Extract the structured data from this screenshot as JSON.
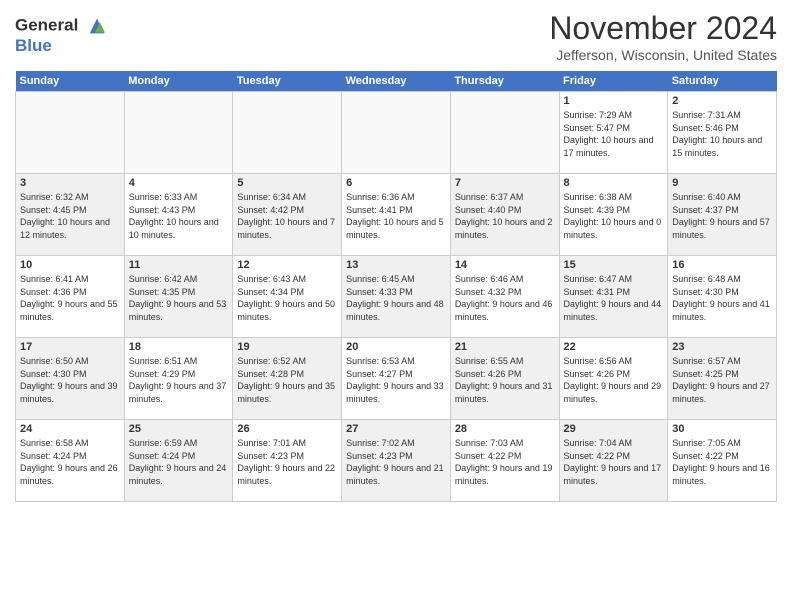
{
  "header": {
    "logo_line1": "General",
    "logo_line2": "Blue",
    "month_year": "November 2024",
    "location": "Jefferson, Wisconsin, United States"
  },
  "days_of_week": [
    "Sunday",
    "Monday",
    "Tuesday",
    "Wednesday",
    "Thursday",
    "Friday",
    "Saturday"
  ],
  "weeks": [
    [
      {
        "day": "",
        "info": "",
        "empty": true
      },
      {
        "day": "",
        "info": "",
        "empty": true
      },
      {
        "day": "",
        "info": "",
        "empty": true
      },
      {
        "day": "",
        "info": "",
        "empty": true
      },
      {
        "day": "",
        "info": "",
        "empty": true
      },
      {
        "day": "1",
        "info": "Sunrise: 7:29 AM\nSunset: 5:47 PM\nDaylight: 10 hours and 17 minutes."
      },
      {
        "day": "2",
        "info": "Sunrise: 7:31 AM\nSunset: 5:46 PM\nDaylight: 10 hours and 15 minutes."
      }
    ],
    [
      {
        "day": "3",
        "info": "Sunrise: 6:32 AM\nSunset: 4:45 PM\nDaylight: 10 hours and 12 minutes.",
        "shaded": true
      },
      {
        "day": "4",
        "info": "Sunrise: 6:33 AM\nSunset: 4:43 PM\nDaylight: 10 hours and 10 minutes."
      },
      {
        "day": "5",
        "info": "Sunrise: 6:34 AM\nSunset: 4:42 PM\nDaylight: 10 hours and 7 minutes.",
        "shaded": true
      },
      {
        "day": "6",
        "info": "Sunrise: 6:36 AM\nSunset: 4:41 PM\nDaylight: 10 hours and 5 minutes."
      },
      {
        "day": "7",
        "info": "Sunrise: 6:37 AM\nSunset: 4:40 PM\nDaylight: 10 hours and 2 minutes.",
        "shaded": true
      },
      {
        "day": "8",
        "info": "Sunrise: 6:38 AM\nSunset: 4:39 PM\nDaylight: 10 hours and 0 minutes."
      },
      {
        "day": "9",
        "info": "Sunrise: 6:40 AM\nSunset: 4:37 PM\nDaylight: 9 hours and 57 minutes.",
        "shaded": true
      }
    ],
    [
      {
        "day": "10",
        "info": "Sunrise: 6:41 AM\nSunset: 4:36 PM\nDaylight: 9 hours and 55 minutes."
      },
      {
        "day": "11",
        "info": "Sunrise: 6:42 AM\nSunset: 4:35 PM\nDaylight: 9 hours and 53 minutes.",
        "shaded": true
      },
      {
        "day": "12",
        "info": "Sunrise: 6:43 AM\nSunset: 4:34 PM\nDaylight: 9 hours and 50 minutes."
      },
      {
        "day": "13",
        "info": "Sunrise: 6:45 AM\nSunset: 4:33 PM\nDaylight: 9 hours and 48 minutes.",
        "shaded": true
      },
      {
        "day": "14",
        "info": "Sunrise: 6:46 AM\nSunset: 4:32 PM\nDaylight: 9 hours and 46 minutes."
      },
      {
        "day": "15",
        "info": "Sunrise: 6:47 AM\nSunset: 4:31 PM\nDaylight: 9 hours and 44 minutes.",
        "shaded": true
      },
      {
        "day": "16",
        "info": "Sunrise: 6:48 AM\nSunset: 4:30 PM\nDaylight: 9 hours and 41 minutes."
      }
    ],
    [
      {
        "day": "17",
        "info": "Sunrise: 6:50 AM\nSunset: 4:30 PM\nDaylight: 9 hours and 39 minutes.",
        "shaded": true
      },
      {
        "day": "18",
        "info": "Sunrise: 6:51 AM\nSunset: 4:29 PM\nDaylight: 9 hours and 37 minutes."
      },
      {
        "day": "19",
        "info": "Sunrise: 6:52 AM\nSunset: 4:28 PM\nDaylight: 9 hours and 35 minutes.",
        "shaded": true
      },
      {
        "day": "20",
        "info": "Sunrise: 6:53 AM\nSunset: 4:27 PM\nDaylight: 9 hours and 33 minutes."
      },
      {
        "day": "21",
        "info": "Sunrise: 6:55 AM\nSunset: 4:26 PM\nDaylight: 9 hours and 31 minutes.",
        "shaded": true
      },
      {
        "day": "22",
        "info": "Sunrise: 6:56 AM\nSunset: 4:26 PM\nDaylight: 9 hours and 29 minutes."
      },
      {
        "day": "23",
        "info": "Sunrise: 6:57 AM\nSunset: 4:25 PM\nDaylight: 9 hours and 27 minutes.",
        "shaded": true
      }
    ],
    [
      {
        "day": "24",
        "info": "Sunrise: 6:58 AM\nSunset: 4:24 PM\nDaylight: 9 hours and 26 minutes."
      },
      {
        "day": "25",
        "info": "Sunrise: 6:59 AM\nSunset: 4:24 PM\nDaylight: 9 hours and 24 minutes.",
        "shaded": true
      },
      {
        "day": "26",
        "info": "Sunrise: 7:01 AM\nSunset: 4:23 PM\nDaylight: 9 hours and 22 minutes."
      },
      {
        "day": "27",
        "info": "Sunrise: 7:02 AM\nSunset: 4:23 PM\nDaylight: 9 hours and 21 minutes.",
        "shaded": true
      },
      {
        "day": "28",
        "info": "Sunrise: 7:03 AM\nSunset: 4:22 PM\nDaylight: 9 hours and 19 minutes."
      },
      {
        "day": "29",
        "info": "Sunrise: 7:04 AM\nSunset: 4:22 PM\nDaylight: 9 hours and 17 minutes.",
        "shaded": true
      },
      {
        "day": "30",
        "info": "Sunrise: 7:05 AM\nSunset: 4:22 PM\nDaylight: 9 hours and 16 minutes."
      }
    ]
  ]
}
